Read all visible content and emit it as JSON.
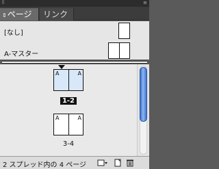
{
  "window": {
    "grip": "⠿",
    "menu_icon": "≡"
  },
  "tabs": {
    "pages": {
      "arrow": "⇕",
      "label": "ページ"
    },
    "links": {
      "label": "リンク"
    }
  },
  "masters": [
    {
      "label": "[なし]"
    },
    {
      "label": "A-マスター"
    }
  ],
  "spreads": [
    {
      "label": "1-2",
      "selected": true,
      "pages": [
        {
          "master": "A"
        },
        {
          "master": "A"
        }
      ]
    },
    {
      "label": "3-4",
      "selected": false,
      "pages": [
        {
          "master": "A"
        },
        {
          "master": "A"
        }
      ]
    }
  ],
  "status": {
    "text": "2 スプレッド内の 4 ページ"
  },
  "icons": {
    "page_size": "▭",
    "new_page": "⊞",
    "delete": "🗑"
  }
}
